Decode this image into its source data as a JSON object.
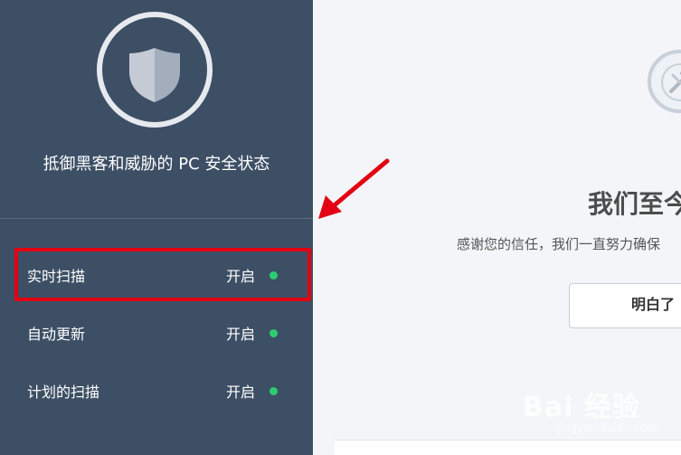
{
  "sidebar": {
    "status_title": "抵御黑客和威胁的 PC 安全状态",
    "features": [
      {
        "label": "实时扫描",
        "status": "开启"
      },
      {
        "label": "自动更新",
        "status": "开启"
      },
      {
        "label": "计划的扫描",
        "status": "开启"
      }
    ],
    "status_color": "#2ecc71"
  },
  "main": {
    "title": "我们至今",
    "description": "感谢您的信任，我们一直努力确保",
    "got_it_button": "明白了"
  },
  "annotation": {
    "highlight_color": "#e30012"
  },
  "watermark": {
    "main": "Bai 经验",
    "sub": "jingyan.baidu.com"
  }
}
